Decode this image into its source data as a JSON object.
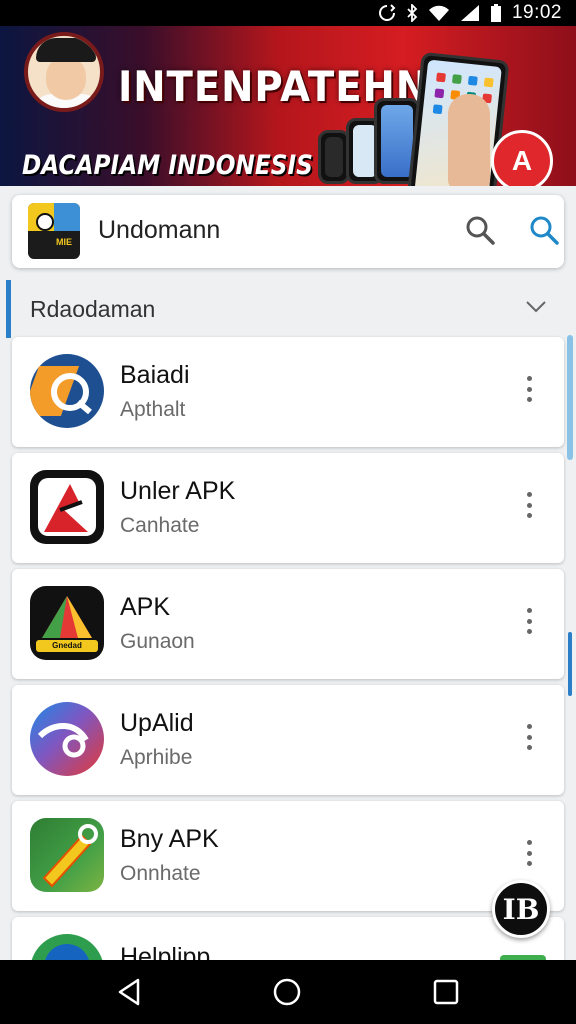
{
  "status_bar": {
    "time": "19:02",
    "icons": [
      "sync-icon",
      "bluetooth-icon",
      "wifi-icon",
      "signal-icon",
      "battery-icon"
    ]
  },
  "banner": {
    "title": "INTENPATEHN",
    "subtitle": "DACAPIAM INDONESIS",
    "badge_label": "A"
  },
  "search": {
    "query": "Undomann",
    "logo_text": "MIE"
  },
  "section": {
    "title": "Rdaodaman"
  },
  "apps": [
    {
      "title": "Baiadi",
      "subtitle": "Apthalt",
      "icon": "blue-arrow-app-icon"
    },
    {
      "title": "Unler APK",
      "subtitle": "Canhate",
      "icon": "red-arrow-app-icon"
    },
    {
      "title": "APK",
      "subtitle": "Gunaon",
      "icon": "triangle-app-icon",
      "icon_label": "Gnedad"
    },
    {
      "title": "UpAlid",
      "subtitle": "Aprhibe",
      "icon": "gradient-swirl-app-icon"
    },
    {
      "title": "Bny APK",
      "subtitle": "Onnhate",
      "icon": "green-tool-app-icon"
    },
    {
      "title": "Helplipp",
      "icon": "green-circle-app-icon"
    }
  ],
  "fab": {
    "label": "IB"
  },
  "colors": {
    "accent": "#2a7fc8",
    "banner_red": "#d51d22",
    "banner_navy": "#0b1640"
  }
}
